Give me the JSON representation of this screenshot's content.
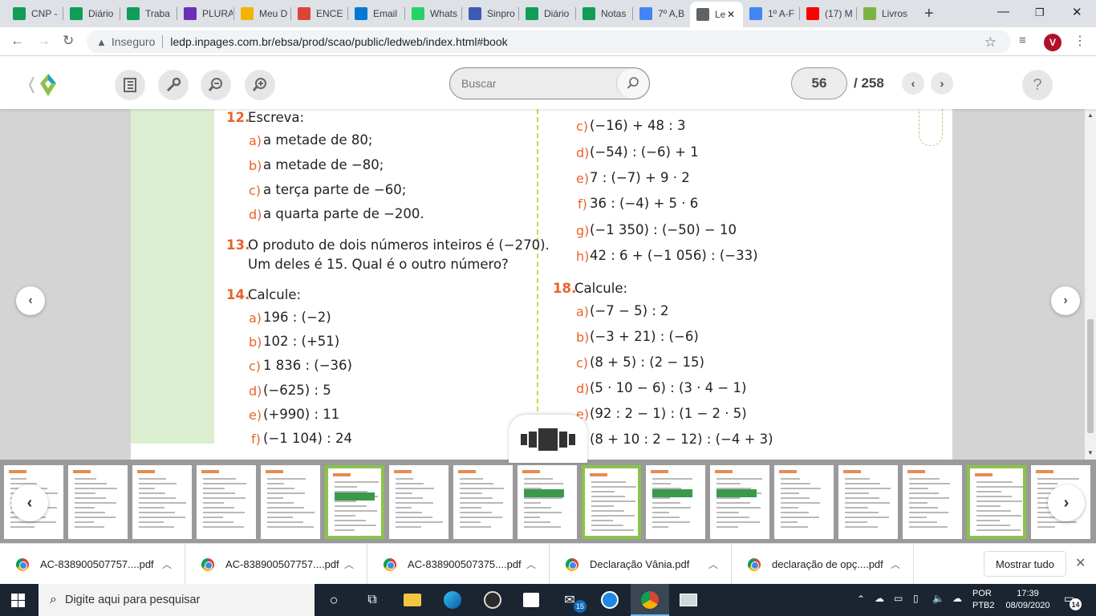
{
  "tabs": [
    {
      "title": "CNP -",
      "icon": "sheets-icon",
      "color": "#0f9d58"
    },
    {
      "title": "Diário",
      "icon": "sheets-icon",
      "color": "#0f9d58"
    },
    {
      "title": "Traba",
      "icon": "sheets-icon",
      "color": "#0f9d58"
    },
    {
      "title": "PLURA",
      "icon": "plurall-icon",
      "color": "#6c2eb9"
    },
    {
      "title": "Meu D",
      "icon": "drive-icon",
      "color": "#f4b400"
    },
    {
      "title": "ENCE",
      "icon": "gmail-icon",
      "color": "#db4437"
    },
    {
      "title": "Email",
      "icon": "outlook-icon",
      "color": "#0078d4"
    },
    {
      "title": "Whats",
      "icon": "whatsapp-icon",
      "color": "#25d366"
    },
    {
      "title": "Sinpro",
      "icon": "sinpro-icon",
      "color": "#3b5bb5"
    },
    {
      "title": "Diário",
      "icon": "sheets-icon",
      "color": "#0f9d58"
    },
    {
      "title": "Notas",
      "icon": "sheets-icon",
      "color": "#0f9d58"
    },
    {
      "title": "7º A,B",
      "icon": "docs-icon",
      "color": "#4285f4"
    },
    {
      "title": "Le",
      "icon": "globe-icon",
      "color": "#5f6368",
      "active": true
    },
    {
      "title": "1º A-F",
      "icon": "docs-icon",
      "color": "#4285f4"
    },
    {
      "title": "(17) M",
      "icon": "youtube-icon",
      "color": "#ff0000"
    },
    {
      "title": "Livros",
      "icon": "livros-icon",
      "color": "#7cb342"
    }
  ],
  "address": {
    "security_label": "Inseguro",
    "url": "ledp.inpages.com.br/ebsa/prod/scao/public/ledweb/index.html#book",
    "profile_initial": "V"
  },
  "reader": {
    "search_placeholder": "Buscar",
    "current_page": "56",
    "total_pages": "/ 258",
    "help_label": "?"
  },
  "book": {
    "left": [
      {
        "num": "12.",
        "text": "Escreva:",
        "items": [
          {
            "l": "a)",
            "t": "a metade de 80;"
          },
          {
            "l": "b)",
            "t": "a metade de −80;"
          },
          {
            "l": "c)",
            "t": "a terça parte de −60;"
          },
          {
            "l": "d)",
            "t": "a quarta parte de −200."
          }
        ]
      },
      {
        "num": "13.",
        "text": "O produto de dois números inteiros é (−270).",
        "text2": "Um deles é 15. Qual é o outro número?"
      },
      {
        "num": "14.",
        "text": "Calcule:",
        "items": [
          {
            "l": "a)",
            "t": "196 : (−2)"
          },
          {
            "l": "b)",
            "t": "102 : (+51)"
          },
          {
            "l": "c)",
            "t": "1 836 : (−36)"
          },
          {
            "l": "d)",
            "t": "(−625) : 5"
          },
          {
            "l": "e)",
            "t": "(+990) : 11"
          },
          {
            "l": "f)",
            "t": "(−1 104) : 24"
          }
        ]
      }
    ],
    "right_top": [
      {
        "l": "c)",
        "t": "(−16) + 48 : 3"
      },
      {
        "l": "d)",
        "t": "(−54) : (−6) + 1"
      },
      {
        "l": "e)",
        "t": "7 : (−7) + 9 · 2"
      },
      {
        "l": "f)",
        "t": "36 : (−4) + 5 · 6"
      },
      {
        "l": "g)",
        "t": "(−1 350) : (−50) − 10"
      },
      {
        "l": "h)",
        "t": "42 : 6 + (−1 056) : (−33)"
      }
    ],
    "q18": {
      "num": "18.",
      "text": "Calcule:",
      "items": [
        {
          "l": "a)",
          "t": "(−7 − 5) : 2"
        },
        {
          "l": "b)",
          "t": "(−3 + 21) : (−6)"
        },
        {
          "l": "c)",
          "t": "(8 + 5) : (2 − 15)"
        },
        {
          "l": "d)",
          "t": "(5 · 10 − 6) : (3 · 4 − 1)"
        },
        {
          "l": "e)",
          "t": "(92 : 2 − 1) : (1 − 2 · 5)"
        },
        {
          "l": "f)",
          "t": "(8 + 10 : 2 − 12) : (−4 + 3)"
        }
      ]
    }
  },
  "downloads": [
    {
      "name": "AC-838900507757....pdf"
    },
    {
      "name": "AC-838900507757....pdf"
    },
    {
      "name": "AC-838900507375....pdf"
    },
    {
      "name": "Declaração Vânia.pdf"
    },
    {
      "name": "declaração de opç....pdf"
    }
  ],
  "downloads_show_all": "Mostrar tudo",
  "taskbar": {
    "search_placeholder": "Digite aqui para pesquisar",
    "mail_badge": "15",
    "lang_line1": "POR",
    "lang_line2": "PTB2",
    "time": "17:39",
    "date": "08/09/2020",
    "notification_count": "14"
  }
}
